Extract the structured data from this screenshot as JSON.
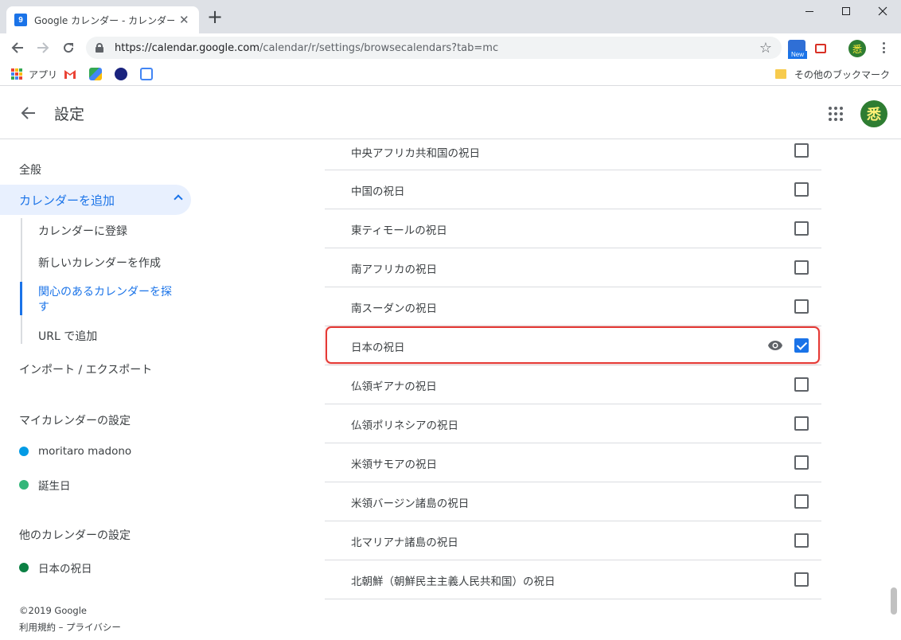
{
  "browser": {
    "tab_title": "Google カレンダー - カレンダーを検索",
    "favicon_text": "9",
    "url_host": "https://calendar.google.com",
    "url_path": "/calendar/r/settings/browsecalendars?tab=mc",
    "new_badge": "New",
    "bookmarks": {
      "apps_label": "アプリ",
      "other_label": "その他のブックマーク"
    }
  },
  "header": {
    "title": "設定",
    "avatar_text": "悉"
  },
  "sidebar": {
    "general": "全般",
    "add_calendar": "カレンダーを追加",
    "sub_items": [
      "カレンダーに登録",
      "新しいカレンダーを作成",
      "関心のあるカレンダーを探す",
      "URL で追加"
    ],
    "import_export": "インポート / エクスポート",
    "my_calendars_title": "マイカレンダーの設定",
    "my_calendars": [
      {
        "name": "moritaro madono",
        "color": "#039be5"
      },
      {
        "name": "誕生日",
        "color": "#33b679"
      }
    ],
    "other_calendars_title": "他のカレンダーの設定",
    "other_calendars": [
      {
        "name": "日本の祝日",
        "color": "#0b8043"
      }
    ],
    "footer_copyright": "©2019 Google",
    "footer_links": "利用規約 – プライバシー"
  },
  "holiday_list": [
    {
      "label": "中央アフリカ共和国の祝日",
      "checked": false
    },
    {
      "label": "中国の祝日",
      "checked": false
    },
    {
      "label": "東ティモールの祝日",
      "checked": false
    },
    {
      "label": "南アフリカの祝日",
      "checked": false
    },
    {
      "label": "南スーダンの祝日",
      "checked": false
    },
    {
      "label": "日本の祝日",
      "checked": true
    },
    {
      "label": "仏領ギアナの祝日",
      "checked": false
    },
    {
      "label": "仏領ポリネシアの祝日",
      "checked": false
    },
    {
      "label": "米領サモアの祝日",
      "checked": false
    },
    {
      "label": "米領バージン諸島の祝日",
      "checked": false
    },
    {
      "label": "北マリアナ諸島の祝日",
      "checked": false
    },
    {
      "label": "北朝鮮（朝鮮民主主義人民共和国）の祝日",
      "checked": false
    }
  ],
  "colors": {
    "accent": "#1a73e8",
    "highlight": "#e53935"
  }
}
